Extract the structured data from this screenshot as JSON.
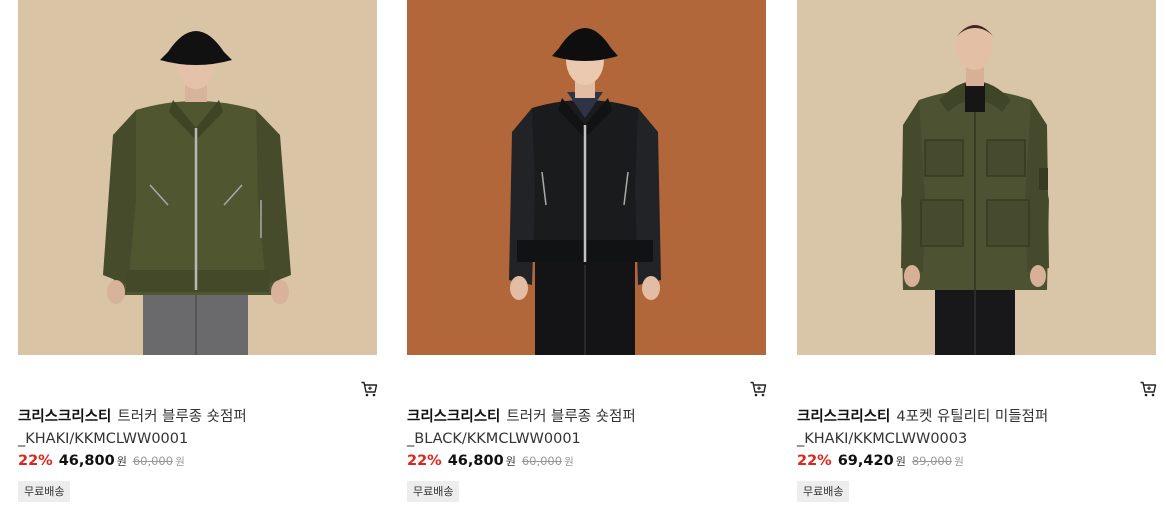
{
  "products": [
    {
      "brand": "크리스크리스티",
      "name_line1": "트러커 블루종 숏점퍼",
      "name_line2": "_KHAKI/KKMCLWW0001",
      "discount": "22%",
      "price": "46,800",
      "currency": "원",
      "original_price": "60,000",
      "badge": "무료배송",
      "image": "model-khaki-trucker-jacket-bucket-hat",
      "bg_color": "#d9c4a6",
      "garment_color": "#4f5630"
    },
    {
      "brand": "크리스크리스티",
      "name_line1": "트러커 블루종 숏점퍼",
      "name_line2": "_BLACK/KKMCLWW0001",
      "discount": "22%",
      "price": "46,800",
      "currency": "원",
      "original_price": "60,000",
      "badge": "무료배송",
      "image": "model-black-trucker-jacket-bucket-hat",
      "bg_color": "#b2673a",
      "garment_color": "#1a1b1d"
    },
    {
      "brand": "크리스크리스티",
      "name_line1": "4포켓 유틸리티 미들점퍼",
      "name_line2": "_KHAKI/KKMCLWW0003",
      "discount": "22%",
      "price": "69,420",
      "currency": "원",
      "original_price": "89,000",
      "badge": "무료배송",
      "image": "model-khaki-4pocket-utility-jacket",
      "bg_color": "#d9c5a8",
      "garment_color": "#4d5332"
    }
  ],
  "icons": {
    "cart": "cart-icon"
  },
  "colors": {
    "discount": "#e2231a",
    "badge_bg": "#ededed"
  }
}
